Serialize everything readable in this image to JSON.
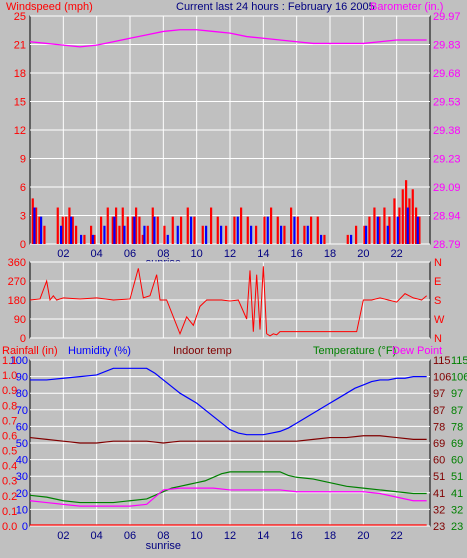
{
  "colors": {
    "background": "#c0c0c0",
    "grid": "#ffffff",
    "windspeed": "#ff0000",
    "wind_gust": "#0000ff",
    "barometer": "#ff00ff",
    "direction": "#ff0000",
    "rainfall": "#ff0000",
    "humidity": "#0000ff",
    "indoor_temp": "#800000",
    "temperature": "#008000",
    "dew_point": "#ff00ff",
    "title": "#000080",
    "label": "#ff0000"
  },
  "header": {
    "title": "Current last 24 hours : February 16 2005"
  },
  "chart_data": [
    {
      "type": "bar",
      "panel": "wind",
      "left_label": "Windspeed (mph)",
      "right_label": "Barometer (in.)",
      "left_ticks": [
        "0",
        "3",
        "6",
        "9",
        "12",
        "15",
        "18",
        "21",
        "25"
      ],
      "right_ticks": [
        "28.79",
        "28.94",
        "29.09",
        "29.23",
        "29.38",
        "29.53",
        "29.68",
        "29.83",
        "29.97"
      ],
      "ylim": [
        0,
        25
      ],
      "barometer_ylim": [
        28.79,
        30.12
      ],
      "x_ticks": [
        "02",
        "04",
        "06",
        "08",
        "10",
        "12",
        "14",
        "16",
        "18",
        "20",
        "22"
      ],
      "x_note": "sunrise",
      "series": [
        {
          "name": "Windspeed",
          "color": "#ff0000",
          "hours": [
            0.1,
            0.3,
            0.5,
            0.8,
            1.6,
            1.9,
            2.1,
            2.3,
            2.5,
            2.7,
            3.2,
            3.6,
            3.8,
            4.2,
            4.6,
            4.9,
            5.1,
            5.3,
            5.5,
            5.8,
            6.1,
            6.3,
            6.5,
            6.7,
            7.0,
            7.3,
            7.6,
            8.0,
            8.5,
            9.0,
            9.4,
            9.8,
            10.3,
            10.8,
            11.2,
            11.7,
            12.2,
            12.6,
            13.0,
            13.5,
            14.0,
            14.4,
            14.8,
            15.2,
            15.6,
            16.0,
            16.4,
            16.8,
            17.2,
            17.6,
            18.0,
            18.5,
            19.0,
            19.5,
            20.0,
            20.3,
            20.6,
            20.9,
            21.2,
            21.5,
            21.8,
            22.1,
            22.3,
            22.5,
            22.7,
            22.9,
            23.1,
            23.3
          ],
          "values": [
            5,
            4,
            3,
            2,
            4,
            3,
            3,
            4,
            3,
            2,
            1,
            2,
            1,
            3,
            4,
            3,
            4,
            2,
            4,
            3,
            3,
            4,
            3,
            1,
            2,
            4,
            3,
            2,
            3,
            3,
            4,
            3,
            2,
            4,
            3,
            2,
            3,
            4,
            3,
            2,
            3,
            4,
            3,
            2,
            4,
            3,
            2,
            3,
            3,
            1,
            0,
            0,
            1,
            2,
            2,
            3,
            4,
            3,
            4,
            3,
            5,
            4,
            6,
            7,
            5,
            6,
            4,
            3
          ]
        },
        {
          "name": "Gust",
          "color": "#0000ff",
          "hours": [
            0.2,
            0.6,
            1.8,
            2.4,
            3.0,
            3.7,
            4.4,
            5.0,
            5.6,
            6.2,
            6.8,
            7.4,
            8.2,
            8.8,
            9.6,
            10.5,
            11.4,
            12.4,
            13.2,
            14.2,
            15.0,
            15.8,
            16.6,
            17.4,
            19.2,
            20.1,
            20.8,
            21.4,
            22.0,
            22.6,
            23.2
          ],
          "values": [
            4,
            3,
            2,
            3,
            1,
            1,
            2,
            3,
            2,
            3,
            2,
            3,
            1,
            2,
            3,
            2,
            2,
            3,
            2,
            3,
            2,
            3,
            2,
            1,
            1,
            2,
            3,
            2,
            3,
            4,
            3
          ]
        },
        {
          "name": "Barometer",
          "color": "#ff00ff",
          "x": [
            0,
            1,
            2,
            3,
            4,
            5,
            6,
            7,
            8,
            9,
            10,
            11,
            12,
            13,
            14,
            15,
            16,
            17,
            18,
            19,
            20,
            21,
            22,
            23,
            23.8
          ],
          "values": [
            29.97,
            29.96,
            29.95,
            29.94,
            29.95,
            29.97,
            29.99,
            30.01,
            30.03,
            30.04,
            30.04,
            30.03,
            30.02,
            30.0,
            29.99,
            29.98,
            29.97,
            29.96,
            29.96,
            29.96,
            29.96,
            29.97,
            29.98,
            29.98,
            29.98
          ]
        }
      ]
    },
    {
      "type": "line",
      "panel": "direction",
      "left_ticks": [
        "0",
        "90",
        "180",
        "270",
        "360"
      ],
      "right_ticks": [
        "N",
        "W",
        "S",
        "E",
        "N"
      ],
      "ylim": [
        0,
        360
      ],
      "series": [
        {
          "name": "Wind direction",
          "color": "#ff0000",
          "x": [
            0.0,
            0.6,
            1.0,
            1.2,
            1.4,
            1.6,
            2.0,
            3.0,
            4.0,
            5.0,
            6.0,
            6.5,
            6.8,
            7.2,
            7.6,
            7.8,
            8.2,
            9.0,
            9.4,
            9.8,
            10.2,
            10.6,
            11.0,
            11.5,
            12.0,
            12.5,
            13.0,
            13.2,
            13.4,
            13.6,
            13.8,
            14.0,
            14.2,
            14.4,
            14.6,
            14.8,
            15.0,
            15.4,
            16.0,
            17.0,
            18.0,
            19.0,
            19.6,
            20.0,
            20.5,
            21.0,
            21.5,
            22.0,
            22.5,
            23.0,
            23.5,
            23.8
          ],
          "values": [
            180,
            185,
            270,
            180,
            200,
            180,
            190,
            185,
            190,
            180,
            185,
            330,
            190,
            200,
            300,
            180,
            180,
            20,
            100,
            60,
            150,
            180,
            180,
            180,
            175,
            180,
            90,
            320,
            30,
            300,
            40,
            340,
            20,
            10,
            20,
            15,
            30,
            30,
            30,
            30,
            30,
            30,
            30,
            180,
            180,
            190,
            180,
            170,
            210,
            190,
            180,
            200
          ]
        }
      ]
    },
    {
      "type": "line",
      "panel": "weather",
      "header_labels": {
        "rainfall": "Rainfall (in)",
        "humidity": "Humidity (%)",
        "indoor": "Indoor temp",
        "temperature": "Temperature (°F)",
        "dewpoint": "Dew Point"
      },
      "humidity_ticks": [
        "0",
        "10",
        "20",
        "30",
        "40",
        "50",
        "60",
        "70",
        "80",
        "90",
        "100"
      ],
      "rain_ticks": [
        "0.0",
        "0.1",
        "0.2",
        "0.3",
        "0.4",
        "0.5",
        "0.6",
        "0.7",
        "0.8",
        "0.9",
        "1.0",
        "1.1"
      ],
      "temp_ticks_a": [
        "23",
        "32",
        "41",
        "51",
        "60",
        "69",
        "78",
        "87",
        "97",
        "106",
        "115"
      ],
      "temp_ticks_b": [
        "23",
        "32",
        "41",
        "51",
        "60",
        "69",
        "78",
        "87",
        "97",
        "106",
        "115"
      ],
      "x_ticks": [
        "02",
        "04",
        "06",
        "08",
        "10",
        "12",
        "14",
        "16",
        "18",
        "20",
        "22"
      ],
      "x_note": "sunrise",
      "humidity_ylim": [
        0,
        100
      ],
      "temp_ylim": [
        23,
        115
      ],
      "series": [
        {
          "name": "Humidity",
          "color": "#0000ff",
          "x": [
            0,
            1,
            2,
            3,
            4,
            5,
            6,
            7,
            7.5,
            8,
            8.5,
            9,
            9.5,
            10,
            10.5,
            11,
            11.5,
            12,
            12.5,
            13,
            13.5,
            14,
            14.5,
            15,
            15.5,
            16,
            16.5,
            17,
            17.5,
            18,
            18.5,
            19,
            19.5,
            20,
            20.5,
            21,
            21.5,
            22,
            22.5,
            23,
            23.8
          ],
          "values": [
            88,
            88,
            89,
            90,
            91,
            95,
            95,
            95,
            92,
            88,
            84,
            80,
            77,
            74,
            70,
            66,
            62,
            58,
            56,
            55,
            55,
            55,
            56,
            57,
            59,
            62,
            65,
            68,
            71,
            74,
            77,
            80,
            83,
            85,
            87,
            88,
            88,
            89,
            89,
            90,
            90
          ]
        },
        {
          "name": "Indoor temp",
          "color": "#800000",
          "x": [
            0,
            1,
            2,
            3,
            4,
            5,
            6,
            7,
            8,
            9,
            10,
            11,
            12,
            13,
            14,
            15,
            16,
            17,
            18,
            19,
            20,
            21,
            22,
            23,
            23.8
          ],
          "values": [
            72,
            71,
            70,
            69,
            69,
            70,
            70,
            70,
            69,
            70,
            70,
            70,
            70,
            70,
            70,
            70,
            70,
            71,
            72,
            72,
            73,
            73,
            72,
            71,
            71
          ]
        },
        {
          "name": "Temperature",
          "color": "#008000",
          "x": [
            0,
            1,
            2,
            3,
            4,
            5,
            6,
            7,
            7.5,
            8,
            8.5,
            9,
            9.5,
            10,
            10.5,
            11,
            11.5,
            12,
            12.5,
            13,
            14,
            15,
            15.5,
            16,
            17,
            18,
            19,
            20,
            21,
            22,
            23,
            23.8
          ],
          "values": [
            40,
            39,
            37,
            36,
            36,
            36,
            37,
            38,
            40,
            42,
            44,
            45,
            46,
            47,
            48,
            50,
            52,
            53,
            53,
            53,
            53,
            53,
            51,
            50,
            49,
            47,
            45,
            44,
            43,
            42,
            41,
            41
          ]
        },
        {
          "name": "Dew Point",
          "color": "#ff00ff",
          "x": [
            0,
            1,
            2,
            3,
            4,
            5,
            6,
            7,
            8,
            9,
            10,
            11,
            12,
            13,
            14,
            15,
            16,
            17,
            18,
            19,
            20,
            21,
            22,
            23,
            23.8
          ],
          "values": [
            37,
            36,
            35,
            34,
            34,
            34,
            34,
            35,
            43,
            44,
            44,
            44,
            43,
            43,
            43,
            43,
            42,
            42,
            42,
            42,
            42,
            41,
            39,
            37,
            37
          ]
        },
        {
          "name": "Rainfall",
          "color": "#ff0000",
          "x": [
            0,
            23.8
          ],
          "values": [
            0.0,
            0.0
          ]
        }
      ]
    }
  ]
}
